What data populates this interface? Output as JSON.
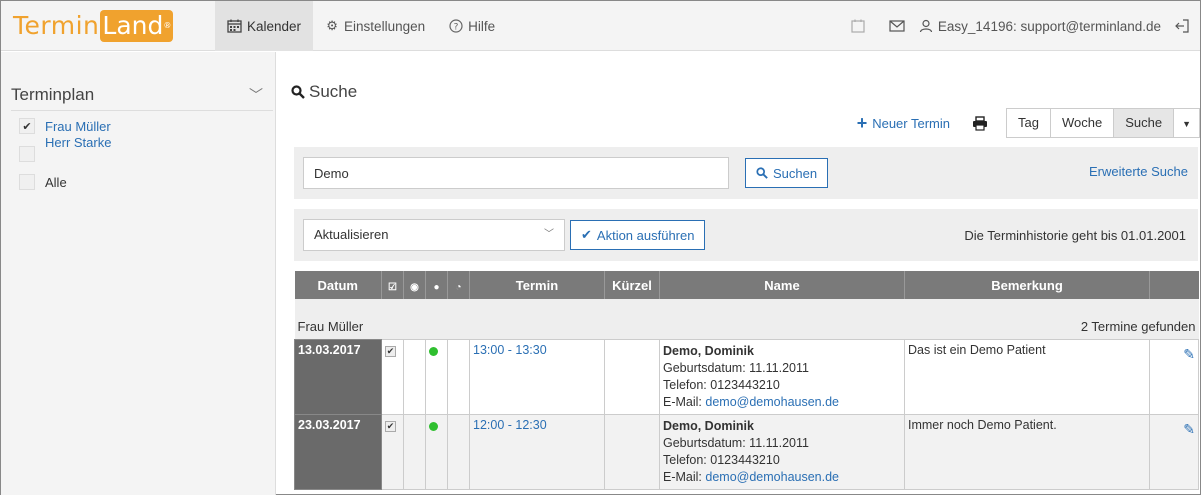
{
  "logo": {
    "part1": "Termin",
    "part2": "Land",
    "reg": "®"
  },
  "nav": {
    "kalender": "Kalender",
    "einstellungen": "Einstellungen",
    "hilfe": "Hilfe"
  },
  "user": {
    "account": "Easy_14196: support@terminland.de"
  },
  "sidebar": {
    "title": "Terminplan",
    "items": [
      {
        "label": "Frau Müller",
        "checked": true
      },
      {
        "label": "Herr Starke",
        "checked": false
      },
      {
        "label": "Alle",
        "checked": false
      }
    ]
  },
  "page": {
    "title": "Suche"
  },
  "toolbar": {
    "new_appointment": "Neuer Termin",
    "views": [
      "Tag",
      "Woche",
      "Suche"
    ],
    "active_view": "Suche"
  },
  "search": {
    "value": "Demo",
    "button": "Suchen",
    "advanced": "Erweiterte Suche"
  },
  "action": {
    "selected": "Aktualisieren",
    "button": "Aktion ausführen",
    "history_note": "Die Terminhistorie geht bis 01.01.2001"
  },
  "table": {
    "headers": {
      "datum": "Datum",
      "termin": "Termin",
      "kuerzel": "Kürzel",
      "name": "Name",
      "bemerkung": "Bemerkung"
    },
    "group": {
      "name": "Frau Müller",
      "count": "2 Termine gefunden"
    },
    "rows": [
      {
        "date": "13.03.2017",
        "time": "13:00 - 13:30",
        "kuerzel": "",
        "name": "Demo, Dominik",
        "birth_label": "Geburtsdatum:",
        "birth": "11.11.2011",
        "phone_label": "Telefon:",
        "phone": "0123443210",
        "email_label": "E-Mail:",
        "email": "demo@demohausen.de",
        "remark": "Das ist ein Demo Patient",
        "status_color": "#2fbf2f"
      },
      {
        "date": "23.03.2017",
        "time": "12:00 - 12:30",
        "kuerzel": "",
        "name": "Demo, Dominik",
        "birth_label": "Geburtsdatum:",
        "birth": "11.11.2011",
        "phone_label": "Telefon:",
        "phone": "0123443210",
        "email_label": "E-Mail:",
        "email": "demo@demohausen.de",
        "remark": "Immer noch Demo Patient.",
        "status_color": "#2fbf2f"
      }
    ]
  },
  "colors": {
    "brand": "#f0a22e",
    "link": "#2a6fb4",
    "header": "#7a7a7a"
  }
}
